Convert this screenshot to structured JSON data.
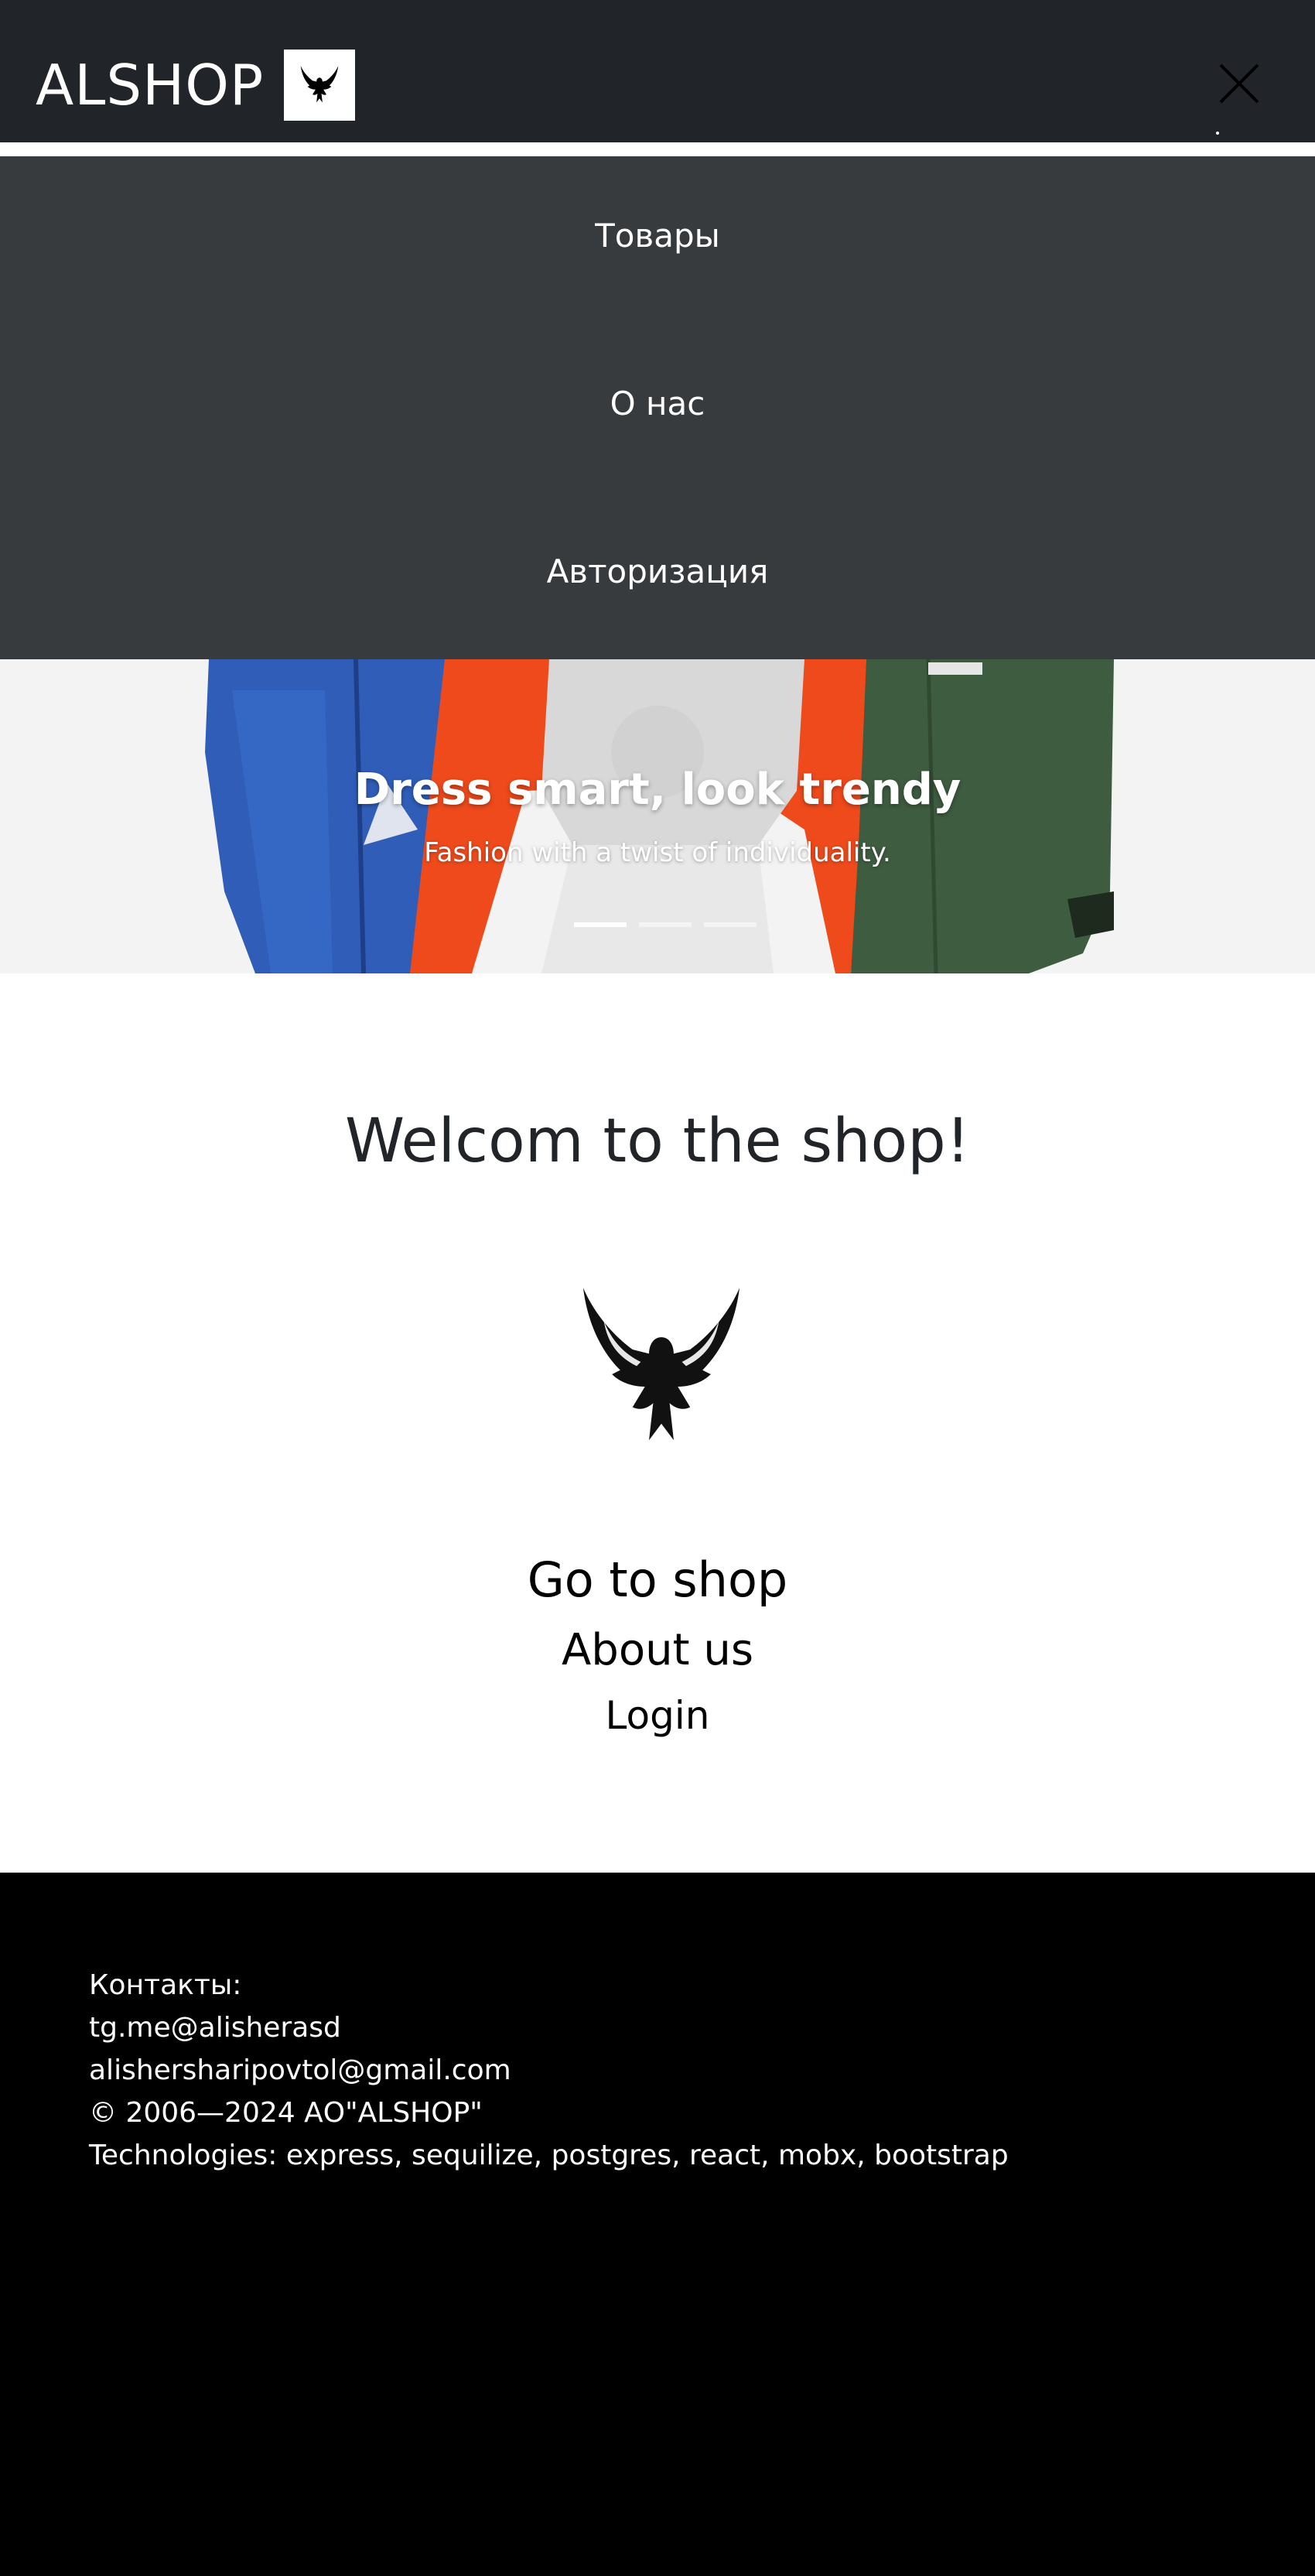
{
  "header": {
    "brand": "ALSHOP",
    "logo_icon": "eagle-icon",
    "close_icon": "close-icon"
  },
  "menu": {
    "items": [
      {
        "label": "Товары"
      },
      {
        "label": "О нас"
      },
      {
        "label": "Авторизация"
      }
    ]
  },
  "carousel": {
    "title": "Dress smart, look trendy",
    "subtitle": "Fashion with a twist of individuality.",
    "slides_count": 3,
    "active_slide": 1
  },
  "main": {
    "welcome": "Welcom to the shop!",
    "logo_icon": "eagle-icon",
    "links": [
      {
        "label": "Go to shop"
      },
      {
        "label": "About us"
      },
      {
        "label": "Login"
      }
    ]
  },
  "footer": {
    "lines": [
      "Контакты:",
      "tg.me@alisherasd",
      "alishersharipovtol@gmail.com",
      "© 2006—2024 АО\"ALSHOP\"",
      "Technologies: express, sequilize, postgres, react, mobx, bootstrap"
    ]
  },
  "colors": {
    "header_bg": "#212529",
    "menu_bg": "#383b3d",
    "footer_bg": "#000000",
    "text_dark": "#212529"
  }
}
